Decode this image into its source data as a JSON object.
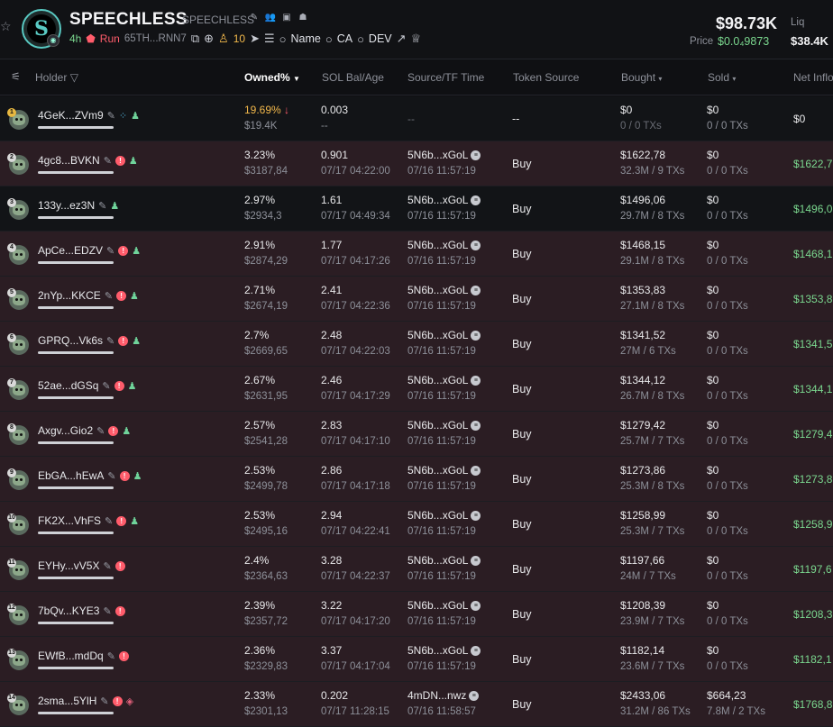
{
  "token": {
    "name": "SPEECHLESS",
    "symbol": "SPEECHLESS",
    "age": "4h",
    "run_label": "Run",
    "address": "65TH...RNN7",
    "holders_count": "10",
    "search_name": "Name",
    "search_ca": "CA",
    "search_dev": "DEV",
    "market_cap": "$98.73K",
    "price_label": "Price",
    "price_value": "$0.0₄9873",
    "liq_label": "Liq",
    "liq_value": "$38.4K"
  },
  "colors": {
    "accent_green": "#7bd88f",
    "accent_red": "#ff5c6b",
    "accent_orange": "#f2b84b",
    "row_highlight": "#2b1d23"
  },
  "columns": {
    "holder": "Holder",
    "owned": "Owned%",
    "sol": "SOL Bal/Age",
    "source_time": "Source/TF Time",
    "token_source": "Token Source",
    "bought": "Bought",
    "sold": "Sold",
    "net": "Net Inflo"
  },
  "rows": [
    {
      "rank": "1",
      "holder": "4GeK...ZVm9",
      "owned": "19.69%",
      "owned_usd": "$19.4K",
      "sol": "0.003",
      "age": "--",
      "src": "--",
      "tf": "",
      "token_source": "--",
      "bought": "$0",
      "bought_tx": "0 / 0 TXs",
      "sold": "$0",
      "sold_tx": "0 / 0 TXs",
      "net": "$0"
    },
    {
      "rank": "2",
      "holder": "4gc8...BVKN",
      "owned": "3.23%",
      "owned_usd": "$3187,84",
      "sol": "0.901",
      "age": "07/17 04:22:00",
      "src": "5N6b...xGoL",
      "tf": "07/16 11:57:19",
      "token_source": "Buy",
      "bought": "$1622,78",
      "bought_tx": "32.3M / 9 TXs",
      "sold": "$0",
      "sold_tx": "0 / 0 TXs",
      "net": "$1622,7"
    },
    {
      "rank": "3",
      "holder": "133y...ez3N",
      "owned": "2.97%",
      "owned_usd": "$2934,3",
      "sol": "1.61",
      "age": "07/17 04:49:34",
      "src": "5N6b...xGoL",
      "tf": "07/16 11:57:19",
      "token_source": "Buy",
      "bought": "$1496,06",
      "bought_tx": "29.7M / 8 TXs",
      "sold": "$0",
      "sold_tx": "0 / 0 TXs",
      "net": "$1496,0"
    },
    {
      "rank": "4",
      "holder": "ApCe...EDZV",
      "owned": "2.91%",
      "owned_usd": "$2874,29",
      "sol": "1.77",
      "age": "07/17 04:17:26",
      "src": "5N6b...xGoL",
      "tf": "07/16 11:57:19",
      "token_source": "Buy",
      "bought": "$1468,15",
      "bought_tx": "29.1M / 8 TXs",
      "sold": "$0",
      "sold_tx": "0 / 0 TXs",
      "net": "$1468,1"
    },
    {
      "rank": "5",
      "holder": "2nYp...KKCE",
      "owned": "2.71%",
      "owned_usd": "$2674,19",
      "sol": "2.41",
      "age": "07/17 04:22:36",
      "src": "5N6b...xGoL",
      "tf": "07/16 11:57:19",
      "token_source": "Buy",
      "bought": "$1353,83",
      "bought_tx": "27.1M / 8 TXs",
      "sold": "$0",
      "sold_tx": "0 / 0 TXs",
      "net": "$1353,8"
    },
    {
      "rank": "6",
      "holder": "GPRQ...Vk6s",
      "owned": "2.7%",
      "owned_usd": "$2669,65",
      "sol": "2.48",
      "age": "07/17 04:22:03",
      "src": "5N6b...xGoL",
      "tf": "07/16 11:57:19",
      "token_source": "Buy",
      "bought": "$1341,52",
      "bought_tx": "27M / 6 TXs",
      "sold": "$0",
      "sold_tx": "0 / 0 TXs",
      "net": "$1341,5"
    },
    {
      "rank": "7",
      "holder": "52ae...dGSq",
      "owned": "2.67%",
      "owned_usd": "$2631,95",
      "sol": "2.46",
      "age": "07/17 04:17:29",
      "src": "5N6b...xGoL",
      "tf": "07/16 11:57:19",
      "token_source": "Buy",
      "bought": "$1344,12",
      "bought_tx": "26.7M / 8 TXs",
      "sold": "$0",
      "sold_tx": "0 / 0 TXs",
      "net": "$1344,1"
    },
    {
      "rank": "8",
      "holder": "Axgv...Gio2",
      "owned": "2.57%",
      "owned_usd": "$2541,28",
      "sol": "2.83",
      "age": "07/17 04:17:10",
      "src": "5N6b...xGoL",
      "tf": "07/16 11:57:19",
      "token_source": "Buy",
      "bought": "$1279,42",
      "bought_tx": "25.7M / 7 TXs",
      "sold": "$0",
      "sold_tx": "0 / 0 TXs",
      "net": "$1279,4"
    },
    {
      "rank": "9",
      "holder": "EbGA...hEwA",
      "owned": "2.53%",
      "owned_usd": "$2499,78",
      "sol": "2.86",
      "age": "07/17 04:17:18",
      "src": "5N6b...xGoL",
      "tf": "07/16 11:57:19",
      "token_source": "Buy",
      "bought": "$1273,86",
      "bought_tx": "25.3M / 8 TXs",
      "sold": "$0",
      "sold_tx": "0 / 0 TXs",
      "net": "$1273,8"
    },
    {
      "rank": "10",
      "holder": "FK2X...VhFS",
      "owned": "2.53%",
      "owned_usd": "$2495,16",
      "sol": "2.94",
      "age": "07/17 04:22:41",
      "src": "5N6b...xGoL",
      "tf": "07/16 11:57:19",
      "token_source": "Buy",
      "bought": "$1258,99",
      "bought_tx": "25.3M / 7 TXs",
      "sold": "$0",
      "sold_tx": "0 / 0 TXs",
      "net": "$1258,9"
    },
    {
      "rank": "11",
      "holder": "EYHy...vV5X",
      "owned": "2.4%",
      "owned_usd": "$2364,63",
      "sol": "3.28",
      "age": "07/17 04:22:37",
      "src": "5N6b...xGoL",
      "tf": "07/16 11:57:19",
      "token_source": "Buy",
      "bought": "$1197,66",
      "bought_tx": "24M / 7 TXs",
      "sold": "$0",
      "sold_tx": "0 / 0 TXs",
      "net": "$1197,6"
    },
    {
      "rank": "12",
      "holder": "7bQv...KYE3",
      "owned": "2.39%",
      "owned_usd": "$2357,72",
      "sol": "3.22",
      "age": "07/17 04:17:20",
      "src": "5N6b...xGoL",
      "tf": "07/16 11:57:19",
      "token_source": "Buy",
      "bought": "$1208,39",
      "bought_tx": "23.9M / 7 TXs",
      "sold": "$0",
      "sold_tx": "0 / 0 TXs",
      "net": "$1208,3"
    },
    {
      "rank": "13",
      "holder": "EWfB...mdDq",
      "owned": "2.36%",
      "owned_usd": "$2329,83",
      "sol": "3.37",
      "age": "07/17 04:17:04",
      "src": "5N6b...xGoL",
      "tf": "07/16 11:57:19",
      "token_source": "Buy",
      "bought": "$1182,14",
      "bought_tx": "23.6M / 7 TXs",
      "sold": "$0",
      "sold_tx": "0 / 0 TXs",
      "net": "$1182,1"
    },
    {
      "rank": "14",
      "holder": "2sma...5YlH",
      "owned": "2.33%",
      "owned_usd": "$2301,13",
      "sol": "0.202",
      "age": "07/17 11:28:15",
      "src": "4mDN...nwz",
      "tf": "07/16 11:58:57",
      "token_source": "Buy",
      "bought": "$2433,06",
      "bought_tx": "31.2M / 86 TXs",
      "sold": "$664,23",
      "sold_tx": "7.8M / 2 TXs",
      "net": "$1768,8"
    }
  ]
}
